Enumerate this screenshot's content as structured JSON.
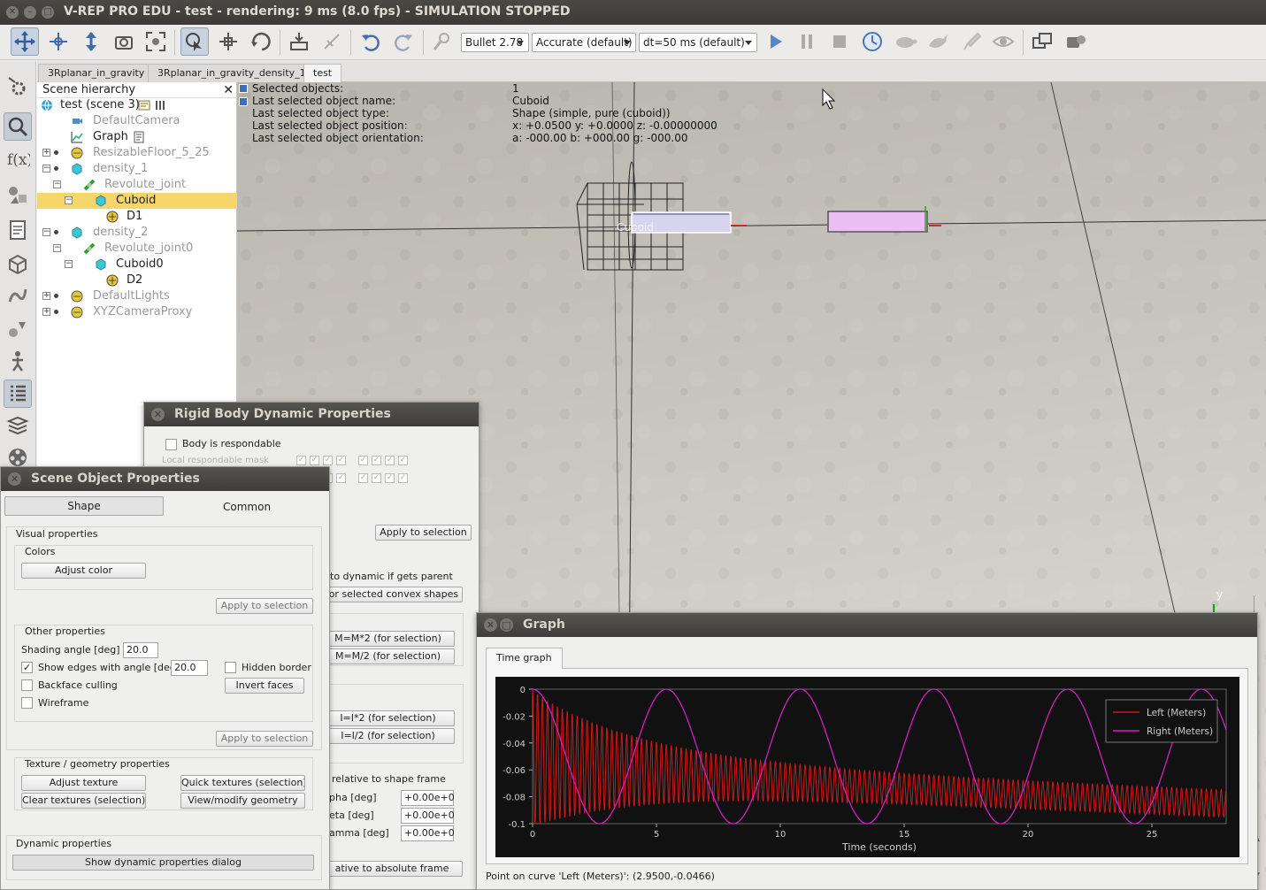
{
  "window": {
    "title": "V-REP PRO EDU - test - rendering: 9 ms (8.0 fps) - SIMULATION STOPPED"
  },
  "toolbar": {
    "engine": "Bullet 2.78",
    "accuracy": "Accurate (default)",
    "timestep": "dt=50 ms (default)"
  },
  "tabs": [
    "3Rplanar_in_gravity",
    "3Rplanar_in_gravity_density_1",
    "test"
  ],
  "hierarchy": {
    "header": "Scene hierarchy",
    "items": [
      {
        "label": "test (scene 3)"
      },
      {
        "label": "DefaultCamera"
      },
      {
        "label": "Graph"
      },
      {
        "label": "ResizableFloor_5_25"
      },
      {
        "label": "density_1"
      },
      {
        "label": "Revolute_joint"
      },
      {
        "label": "Cuboid"
      },
      {
        "label": "D1"
      },
      {
        "label": "density_2"
      },
      {
        "label": "Revolute_joint0"
      },
      {
        "label": "Cuboid0"
      },
      {
        "label": "D2"
      },
      {
        "label": "DefaultLights"
      },
      {
        "label": "XYZCameraProxy"
      }
    ]
  },
  "info": {
    "labels": [
      "Selected objects:",
      "Last selected object name:",
      "Last selected object type:",
      "Last selected object position:",
      "Last selected object orientation:"
    ],
    "values": [
      "1",
      "Cuboid",
      "Shape (simple, pure (cuboid))",
      "x: +0.0500    y: +0.0000    z: -0.00000000",
      "a: -000.00    b: +000.00    g: -000.00"
    ]
  },
  "scene": {
    "object_label": "Cuboid",
    "axis_label": "y"
  },
  "rigid": {
    "title": "Rigid Body Dynamic Properties",
    "respondable": "Body is respondable",
    "mask_label": "Local respondable mask",
    "apply": "Apply to selection",
    "dynamic_parent": "to dynamic if gets parent",
    "convex": "for selected convex shapes",
    "mass_x2": "M=M*2  (for selection)",
    "mass_d2": "M=M/2  (for selection)",
    "inertia_x2": "I=I*2  (for selection)",
    "inertia_d2": "I=I/2  (for selection)",
    "rel_shape": "relative to shape frame",
    "alpha_label": "pha [deg]",
    "beta_label": "eta [deg]",
    "gamma_label": "amma [deg]",
    "alpha_val": "+0.00e+0",
    "beta_val": "+0.00e+0",
    "gamma_val": "+0.00e+0",
    "rel_abs": "ative to absolute frame"
  },
  "props": {
    "title": "Scene Object Properties",
    "tab_shape": "Shape",
    "tab_common": "Common",
    "visual": "Visual properties",
    "colors": "Colors",
    "adjust_color": "Adjust color",
    "apply": "Apply to selection",
    "other": "Other properties",
    "shading_label": "Shading angle [deg]",
    "shading_val": "20.0",
    "show_edges": "Show edges with angle [deg]",
    "edges_val": "20.0",
    "hidden_border": "Hidden border",
    "backface": "Backface culling",
    "invert": "Invert faces",
    "wireframe": "Wireframe",
    "texture_group": "Texture / geometry properties",
    "adjust_texture": "Adjust texture",
    "quick_textures": "Quick textures (selection)",
    "clear_textures": "Clear textures (selection)",
    "view_geom": "View/modify geometry",
    "dynamic_group": "Dynamic properties",
    "show_dynamic": "Show dynamic properties dialog"
  },
  "graph": {
    "title": "Graph",
    "tab": "Time graph",
    "status": "Point on curve 'Left (Meters)': (2.9500,-0.0466)"
  },
  "chart_data": {
    "type": "line",
    "xlabel": "Time (seconds)",
    "ylabel": "",
    "xlim": [
      0,
      28
    ],
    "ylim": [
      -0.1,
      0.0
    ],
    "xticks": [
      "0",
      "5",
      "10",
      "15",
      "20",
      "25"
    ],
    "yticks": [
      "0",
      "-0.02",
      "-0.04",
      "-0.06",
      "-0.08",
      "-0.1"
    ],
    "legend_position": "top-right",
    "series": [
      {
        "name": "Left (Meters)",
        "color": "#d01818",
        "kind": "damped oscillation",
        "center_start": -0.05,
        "center_end": -0.085,
        "amplitude_start": 0.05,
        "amplitude_end": 0.01,
        "period": 0.2
      },
      {
        "name": "Right (Meters)",
        "color": "#d020c0",
        "kind": "sinusoid",
        "min": -0.1,
        "max": 0.0,
        "period": 5.4,
        "phase_peak_at": 5.4
      }
    ]
  },
  "colors": {
    "accent": "#f8d56a",
    "titlebar": "#3e3d39",
    "graph_bg": "#111111",
    "left_series": "#d01818",
    "right_series": "#d020c0"
  }
}
